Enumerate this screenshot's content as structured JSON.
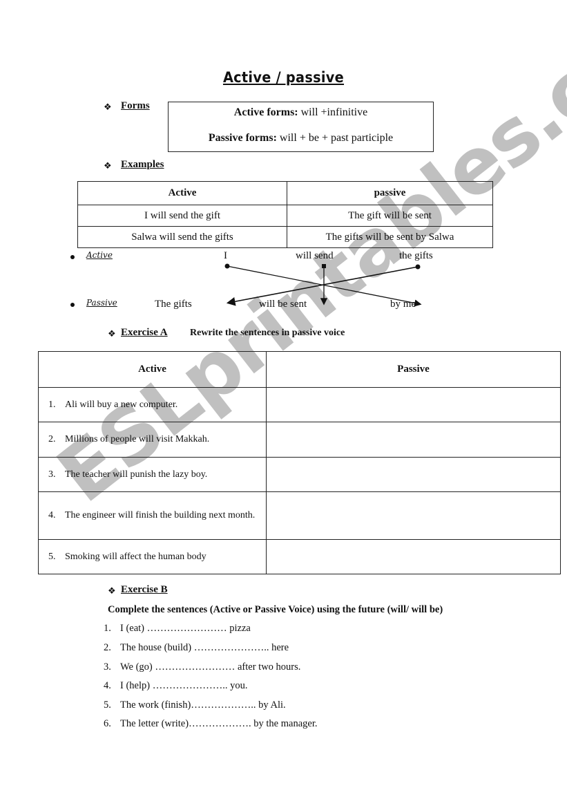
{
  "title": "Active / passive",
  "forms": {
    "heading": "Forms",
    "active_label": "Active forms:",
    "active_rule": " will +infinitive",
    "passive_label": "Passive forms:",
    "passive_rule": " will + be + past participle"
  },
  "examples": {
    "heading": "Examples",
    "headers": [
      "Active",
      "passive"
    ],
    "rows": [
      [
        "I will send the gift",
        "The gift will be sent"
      ],
      [
        "Salwa will send the gifts",
        "The gifts will be sent by Salwa"
      ]
    ]
  },
  "diagram": {
    "active_label": "Active",
    "passive_label": "Passive",
    "active_words": [
      "I",
      "will send",
      "the gifts"
    ],
    "passive_words": [
      "The gifts",
      "will be sent",
      "by me"
    ]
  },
  "exercise_a": {
    "heading": "Exercise A",
    "instruction": "Rewrite the sentences in passive voice",
    "headers": [
      "Active",
      "Passive"
    ],
    "rows": [
      {
        "num": "1.",
        "text": "Ali will buy a new computer."
      },
      {
        "num": "2.",
        "text": "Millions of people will visit Makkah."
      },
      {
        "num": "3.",
        "text": "The teacher will punish the lazy boy."
      },
      {
        "num": "4.",
        "text": "The engineer will finish the building next month."
      },
      {
        "num": "5.",
        "text": "Smoking will affect the human body"
      }
    ]
  },
  "exercise_b": {
    "heading": "Exercise B",
    "instruction": "Complete the sentences (Active or Passive Voice) using the future  (will/ will be)",
    "items": [
      {
        "num": "1.",
        "text": "I (eat) …………………… pizza"
      },
      {
        "num": "2.",
        "text": "The house (build) ………………….. here"
      },
      {
        "num": "3.",
        "text": "We (go) …………………… after two hours."
      },
      {
        "num": "4.",
        "text": "I (help) ………………….. you."
      },
      {
        "num": "5.",
        "text": "The work (finish)……………….. by Ali."
      },
      {
        "num": "6.",
        "text": "The letter (write)………………. by the manager."
      }
    ]
  },
  "watermark": "ESLprintables.com"
}
